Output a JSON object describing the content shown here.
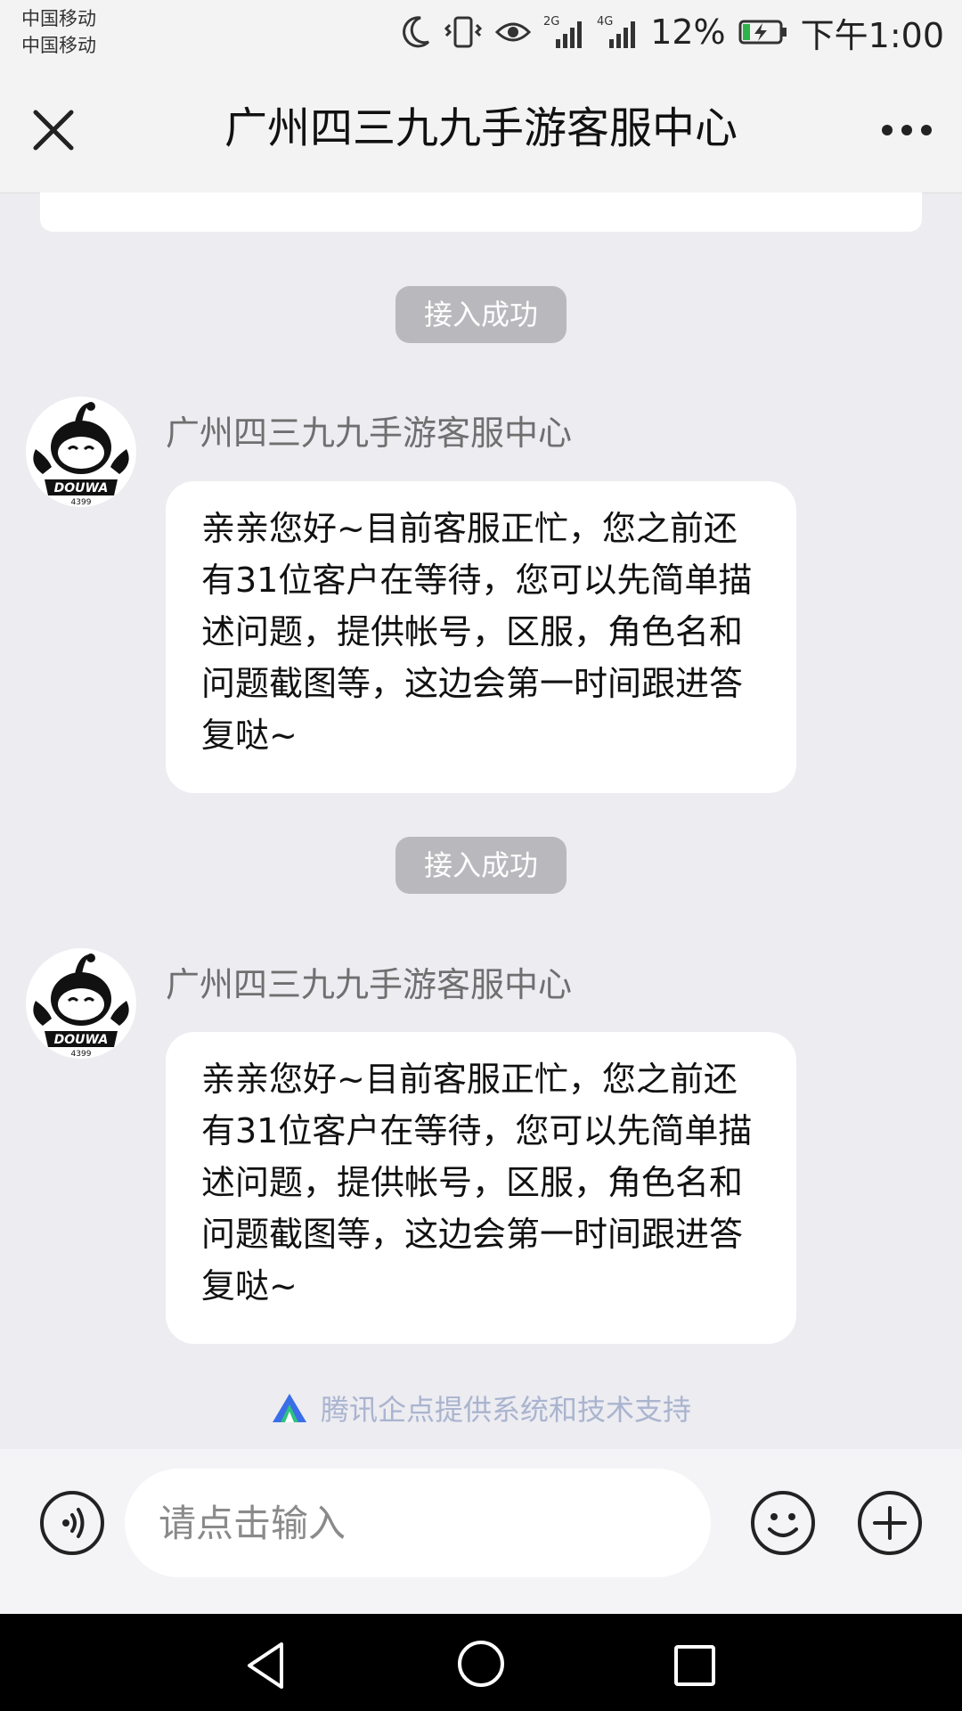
{
  "status_bar": {
    "carrier_1": "中国移动",
    "carrier_2": "中国移动",
    "net_2g": "2G",
    "net_4g": "4G",
    "battery": "12%",
    "time": "下午1:00",
    "battery_color": "#2db34a"
  },
  "nav": {
    "title": "广州四三九九手游客服中心"
  },
  "chat": {
    "messages": [
      {
        "system_tag": "接入成功",
        "sender": "广州四三九九手游客服中心",
        "avatar_brand": "DOUWA",
        "avatar_sub": "4399",
        "text": "亲亲您好~目前客服正忙，您之前还有31位客户在等待，您可以先简单描述问题，提供帐号，区服，角色名和问题截图等，这边会第一时间跟进答复哒~"
      },
      {
        "system_tag": "接入成功",
        "sender": "广州四三九九手游客服中心",
        "avatar_brand": "DOUWA",
        "avatar_sub": "4399",
        "text": "亲亲您好~目前客服正忙，您之前还有31位客户在等待，您可以先简单描述问题，提供帐号，区服，角色名和问题截图等，这边会第一时间跟进答复哒~"
      }
    ],
    "powered_by": "腾讯企点提供系统和技术支持"
  },
  "input": {
    "placeholder": "请点击输入"
  }
}
